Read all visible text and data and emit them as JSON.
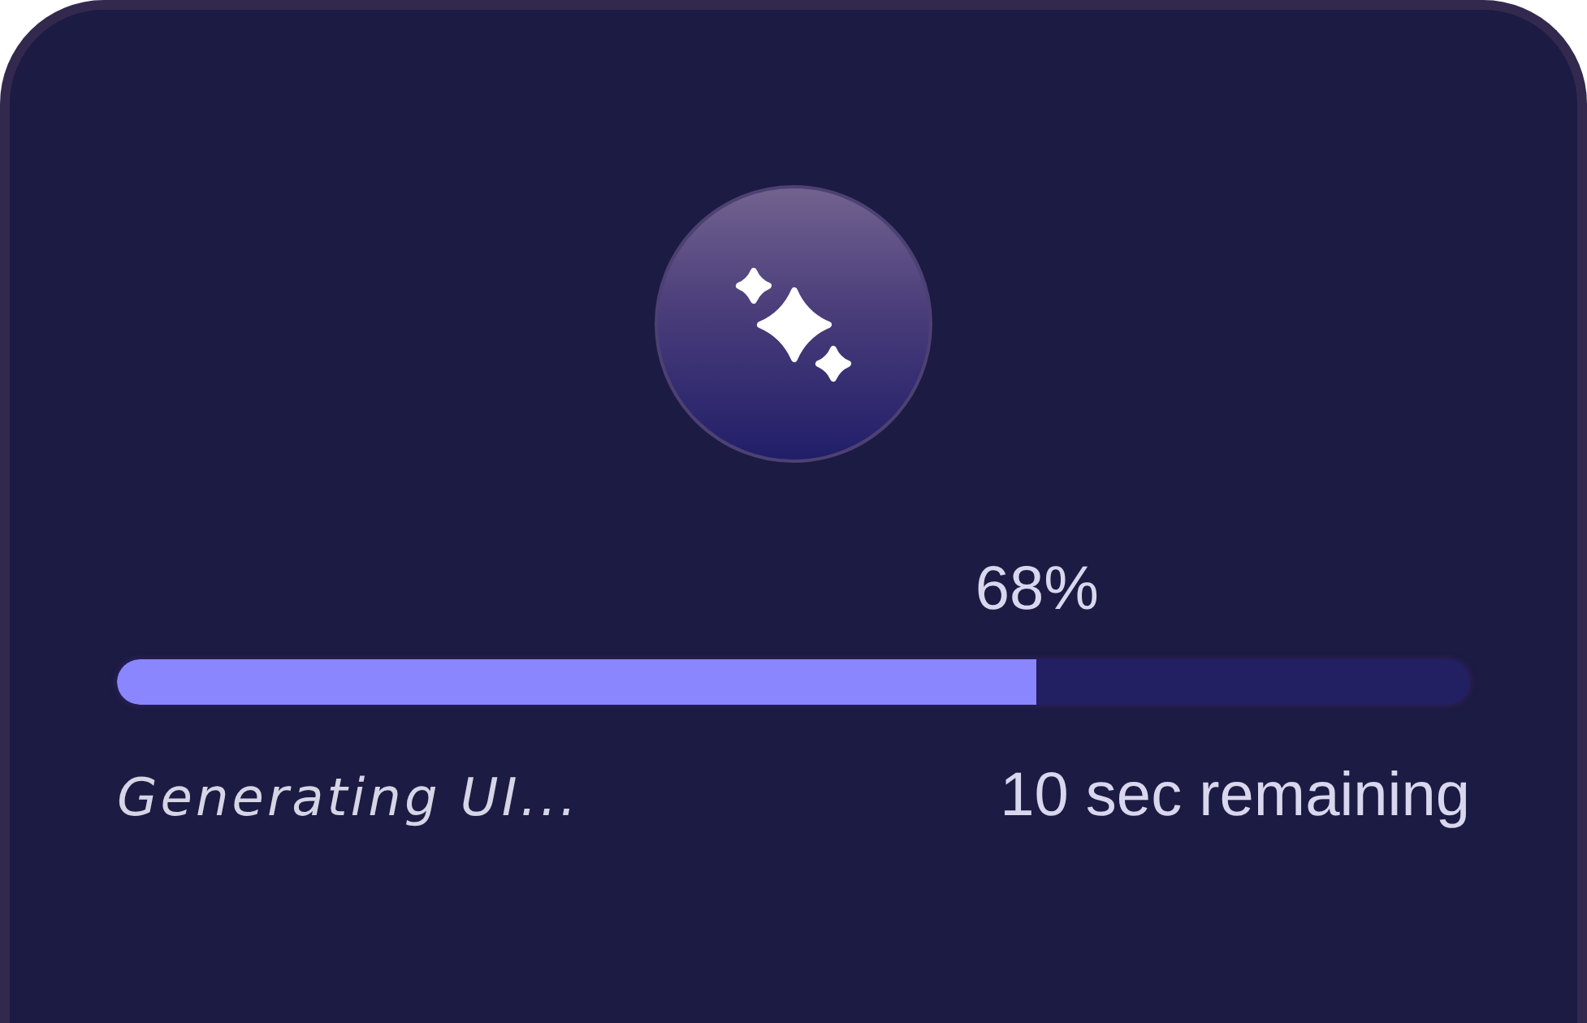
{
  "progress": {
    "percent": "68%",
    "level": 0.68
  },
  "status": "Generating UI...",
  "remaining": "10 sec remaining"
}
